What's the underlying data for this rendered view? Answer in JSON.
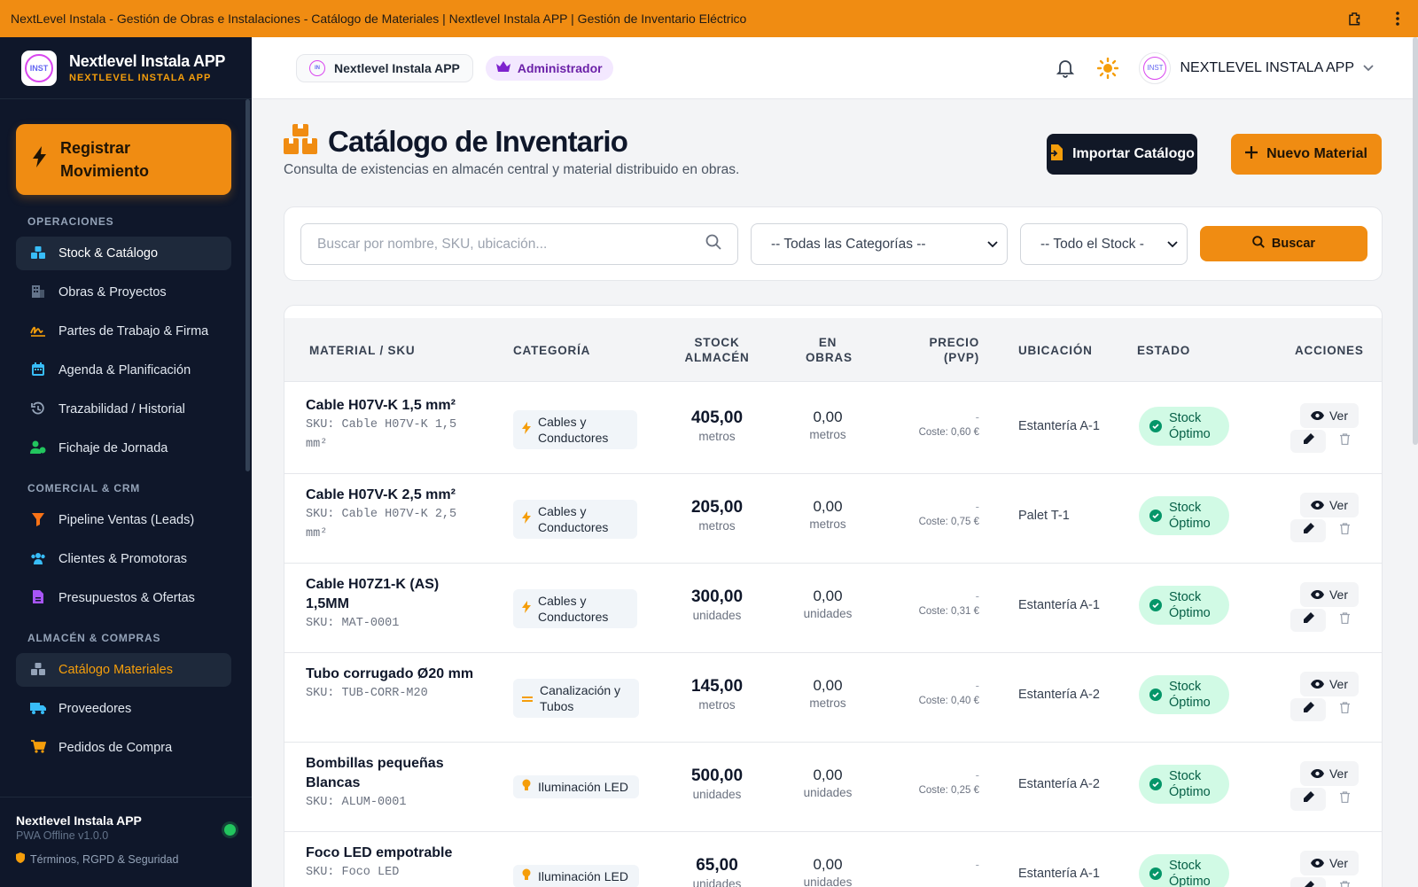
{
  "window": {
    "title": "NextLevel Instala - Gestión de Obras e Instalaciones - Catálogo de Materiales | Nextlevel Instala APP | Gestión de Inventario Eléctrico"
  },
  "sidebar": {
    "brand_title": "Nextlevel Instala APP",
    "brand_subtitle": "NEXTLEVEL INSTALA APP",
    "logo_text": "INST",
    "register_button": "Registrar Movimiento",
    "sections": [
      {
        "label": "OPERACIONES"
      },
      {
        "label": "COMERCIAL & CRM"
      },
      {
        "label": "ALMACÉN & COMPRAS"
      }
    ],
    "items": [
      {
        "label": "Stock & Catálogo",
        "icon": "boxes-icon"
      },
      {
        "label": "Obras & Proyectos",
        "icon": "building-icon"
      },
      {
        "label": "Partes de Trabajo & Firma",
        "icon": "signature-icon"
      },
      {
        "label": "Agenda & Planificación",
        "icon": "calendar-icon"
      },
      {
        "label": "Trazabilidad / Historial",
        "icon": "history-icon"
      },
      {
        "label": "Fichaje de Jornada",
        "icon": "user-clock-icon"
      },
      {
        "label": "Pipeline Ventas (Leads)",
        "icon": "funnel-icon"
      },
      {
        "label": "Clientes & Promotoras",
        "icon": "users-icon"
      },
      {
        "label": "Presupuestos & Ofertas",
        "icon": "file-invoice-icon"
      },
      {
        "label": "Catálogo Materiales",
        "icon": "boxes-icon"
      },
      {
        "label": "Proveedores",
        "icon": "truck-icon"
      },
      {
        "label": "Pedidos de Compra",
        "icon": "cart-icon"
      }
    ],
    "footer": {
      "title": "Nextlevel Instala APP",
      "version": "PWA Offline v1.0.0",
      "legal": "Términos, RGPD & Seguridad"
    }
  },
  "header": {
    "app_chip": "Nextlevel Instala APP",
    "role_chip": "Administrador",
    "user_name": "NEXTLEVEL INSTALA APP"
  },
  "page": {
    "title": "Catálogo de Inventario",
    "subtitle": "Consulta de existencias en almacén central y material distribuido en obras.",
    "import_button": "Importar Catálogo",
    "new_button": "Nuevo Material"
  },
  "filters": {
    "search_placeholder": "Buscar por nombre, SKU, ubicación...",
    "category_select": "-- Todas las Categorías --",
    "stock_select": "-- Todo el Stock -",
    "search_button": "Buscar"
  },
  "table": {
    "headers": {
      "material": "MATERIAL / SKU",
      "category": "CATEGORÍA",
      "stock": "STOCK ALMACÉN",
      "obras": "EN OBRAS",
      "price": "PRECIO (PVP)",
      "location": "UBICACIÓN",
      "status": "ESTADO",
      "actions": "ACCIONES"
    },
    "view_label": "Ver",
    "rows": [
      {
        "name": "Cable H07V-K 1,5 mm²",
        "sku": "SKU: Cable H07V-K 1,5 mm²",
        "category": "Cables y Conductores",
        "cat_icon": "bolt-icon",
        "stock": "405,00",
        "stock_unit": "metros",
        "obras": "0,00",
        "obras_unit": "metros",
        "price": "-",
        "cost": "Coste: 0,60 €",
        "location": "Estantería A-1",
        "status": "Stock Óptimo"
      },
      {
        "name": "Cable H07V-K 2,5 mm²",
        "sku": "SKU: Cable H07V-K 2,5 mm²",
        "category": "Cables y Conductores",
        "cat_icon": "bolt-icon",
        "stock": "205,00",
        "stock_unit": "metros",
        "obras": "0,00",
        "obras_unit": "metros",
        "price": "-",
        "cost": "Coste: 0,75 €",
        "location": "Palet T-1",
        "status": "Stock Óptimo"
      },
      {
        "name": "Cable H07Z1-K (AS) 1,5MM",
        "sku": "SKU: MAT-0001",
        "category": "Cables y Conductores",
        "cat_icon": "bolt-icon",
        "stock": "300,00",
        "stock_unit": "unidades",
        "obras": "0,00",
        "obras_unit": "unidades",
        "price": "-",
        "cost": "Coste: 0,31 €",
        "location": "Estantería A-1",
        "status": "Stock Óptimo"
      },
      {
        "name": "Tubo corrugado Ø20 mm",
        "sku": "SKU: TUB-CORR-M20",
        "category": "Canalización y Tubos",
        "cat_icon": "pipe-icon",
        "stock": "145,00",
        "stock_unit": "metros",
        "obras": "0,00",
        "obras_unit": "metros",
        "price": "-",
        "cost": "Coste: 0,40 €",
        "location": "Estantería A-2",
        "status": "Stock Óptimo"
      },
      {
        "name": "Bombillas pequeñas Blancas",
        "sku": "SKU: ALUM-0001",
        "category": "Iluminación LED",
        "cat_icon": "lightbulb-icon",
        "stock": "500,00",
        "stock_unit": "unidades",
        "obras": "0,00",
        "obras_unit": "unidades",
        "price": "-",
        "cost": "Coste: 0,25 €",
        "location": "Estantería A-2",
        "status": "Stock Óptimo"
      },
      {
        "name": "Foco LED empotrable",
        "sku": "SKU: Foco LED",
        "category": "Iluminación LED",
        "cat_icon": "lightbulb-icon",
        "stock": "65,00",
        "stock_unit": "unidades",
        "obras": "0,00",
        "obras_unit": "unidades",
        "price": "-",
        "cost": "",
        "location": "Estantería A-1",
        "status": "Stock Óptimo"
      }
    ]
  },
  "colors": {
    "accent": "#f08c12",
    "sidebar_bg": "#0f172a",
    "status_ok_bg": "#d1fae5",
    "status_ok_text": "#065f46"
  }
}
